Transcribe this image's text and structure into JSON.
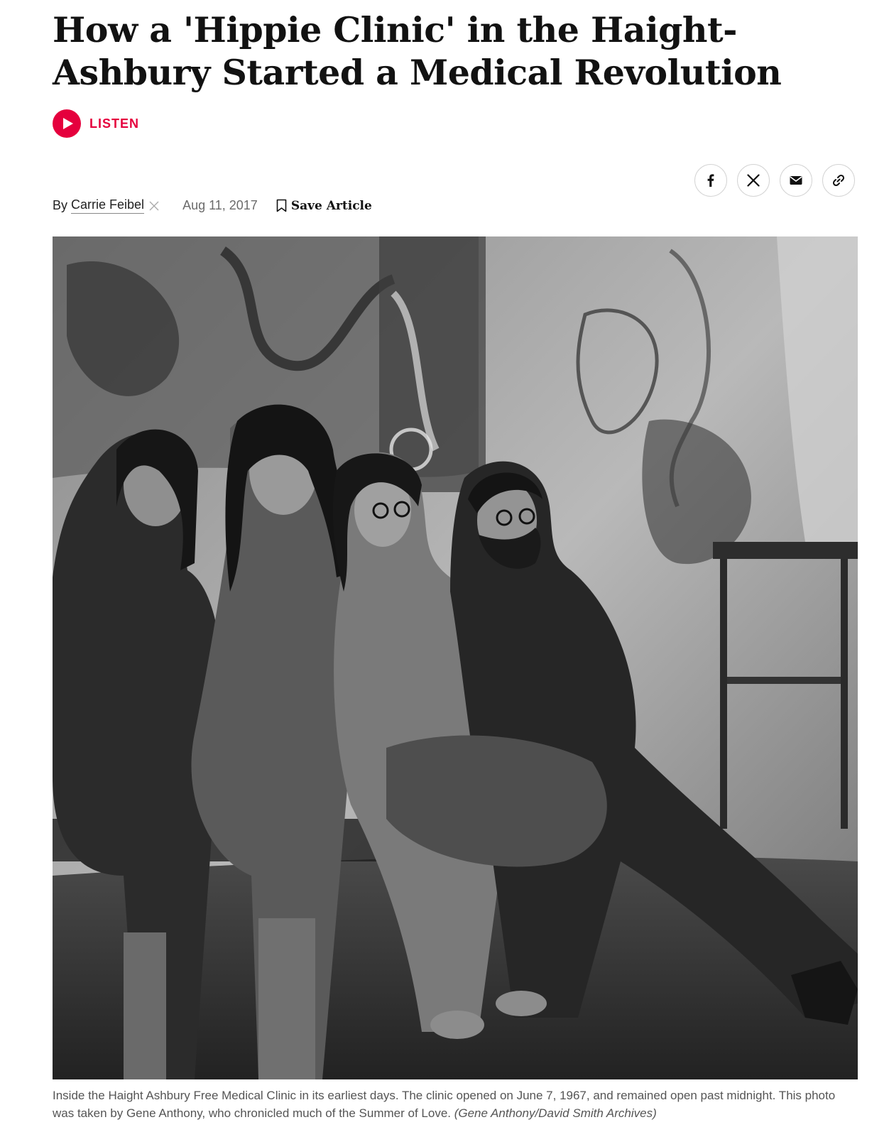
{
  "article": {
    "headline": "How a 'Hippie Clinic' in the Haight-Ashbury Started a Medical Revolution",
    "listen_label": "LISTEN",
    "byline_prefix": "By",
    "author": "Carrie Feibel",
    "date": "Aug 11, 2017",
    "save_label": "Save Article"
  },
  "share": {
    "icons": [
      "facebook-icon",
      "x-icon",
      "email-icon",
      "link-icon"
    ]
  },
  "photo": {
    "alt": "Black and white photo of four young people seated in a clinic waiting room with psychedelic posters on the wall",
    "tone": "grayscale"
  },
  "caption": {
    "text": "Inside the Haight Ashbury Free Medical Clinic in its earliest days. The clinic opened on June 7, 1967, and remained open past midnight. This photo was taken by Gene Anthony, who chronicled much of the Summer of Love. ",
    "credit": "(Gene Anthony/David Smith Archives)"
  },
  "colors": {
    "accent": "#e5003d",
    "headline": "#121212",
    "meta": "#6b6b6b",
    "caption": "#555555"
  }
}
